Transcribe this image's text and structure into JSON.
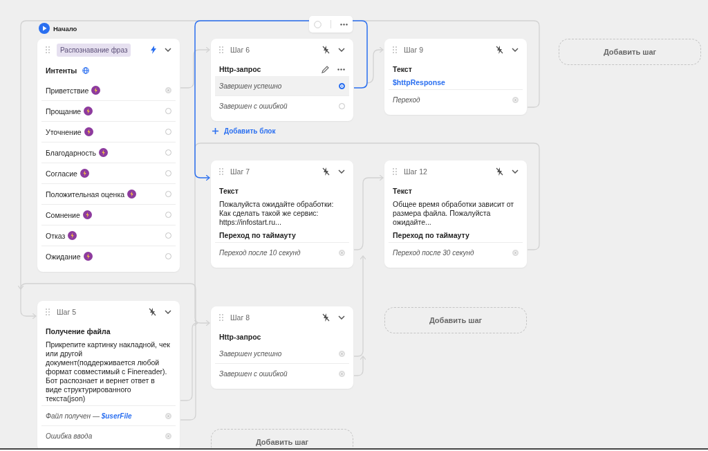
{
  "start": {
    "label": "Начало"
  },
  "intent_card": {
    "trigger": "Распознавание фраз",
    "title": "Интенты",
    "intents": [
      {
        "label": "Приветствие",
        "connected": true
      },
      {
        "label": "Прощание",
        "connected": false
      },
      {
        "label": "Уточнение",
        "connected": false
      },
      {
        "label": "Благодарность",
        "connected": false
      },
      {
        "label": "Согласие",
        "connected": false
      },
      {
        "label": "Положительная оценка",
        "connected": false
      },
      {
        "label": "Сомнение",
        "connected": false
      },
      {
        "label": "Отказ",
        "connected": false
      },
      {
        "label": "Ожидание",
        "connected": false
      }
    ]
  },
  "steps": [
    {
      "title": "Шаг 6",
      "block": "Http-запрос",
      "editable": true,
      "outputs": [
        {
          "label": "Завершен успешно",
          "connected": true,
          "selected": true
        },
        {
          "label": "Завершен с ошибкой",
          "connected": false,
          "selected": false
        }
      ],
      "add_block": "Добавить блок"
    },
    {
      "title": "Шаг 9",
      "block": "Текст",
      "editable": false,
      "lines": [
        {
          "kind": "variable",
          "text": "$httpResponse"
        }
      ],
      "outputs": [
        {
          "label": "Переход",
          "connected": true,
          "selected": false
        }
      ]
    },
    {
      "title": "Шаг 7",
      "block": "Текст",
      "editable": false,
      "lines": [
        {
          "kind": "text",
          "text": "Пожалуйста ожидайте обработки:\nКак сделать такой же сервис:\nhttps://infostart.ru..."
        },
        {
          "kind": "subtitle",
          "text": "Переход по таймауту"
        }
      ],
      "outputs": [
        {
          "label": "Переход после 10 секунд",
          "connected": true,
          "selected": false
        }
      ]
    },
    {
      "title": "Шаг 12",
      "block": "Текст",
      "editable": false,
      "lines": [
        {
          "kind": "text",
          "text": "Общее время обработки зависит от размера файла. Пожалуйста ожидайте..."
        },
        {
          "kind": "subtitle",
          "text": "Переход по таймауту"
        }
      ],
      "outputs": [
        {
          "label": "Переход после 30 секунд",
          "connected": true,
          "selected": false
        }
      ]
    },
    {
      "title": "Шаг 5",
      "block": "Получение файла",
      "editable": false,
      "lines": [
        {
          "kind": "text",
          "text": "Прикрепите картинку накладной, чек или другой документ(поддерживается любой формат совместимый с Finereader). Бот распознает и вернет ответ в виде структурированного текста(json)"
        }
      ],
      "outputs": [
        {
          "label": "Файл получен — **$userFile**",
          "connected": true,
          "selected": false
        },
        {
          "label": "Ошибка ввода",
          "connected": true,
          "selected": false
        }
      ]
    },
    {
      "title": "Шаг 8",
      "block": "Http-запрос",
      "editable": false,
      "outputs": [
        {
          "label": "Завершен успешно",
          "connected": true,
          "selected": false
        },
        {
          "label": "Завершен с ошибкой",
          "connected": true,
          "selected": false
        }
      ]
    }
  ],
  "add_step_buttons": [
    "Добавить шаг",
    "Добавить шаг",
    "Добавить шаг"
  ]
}
